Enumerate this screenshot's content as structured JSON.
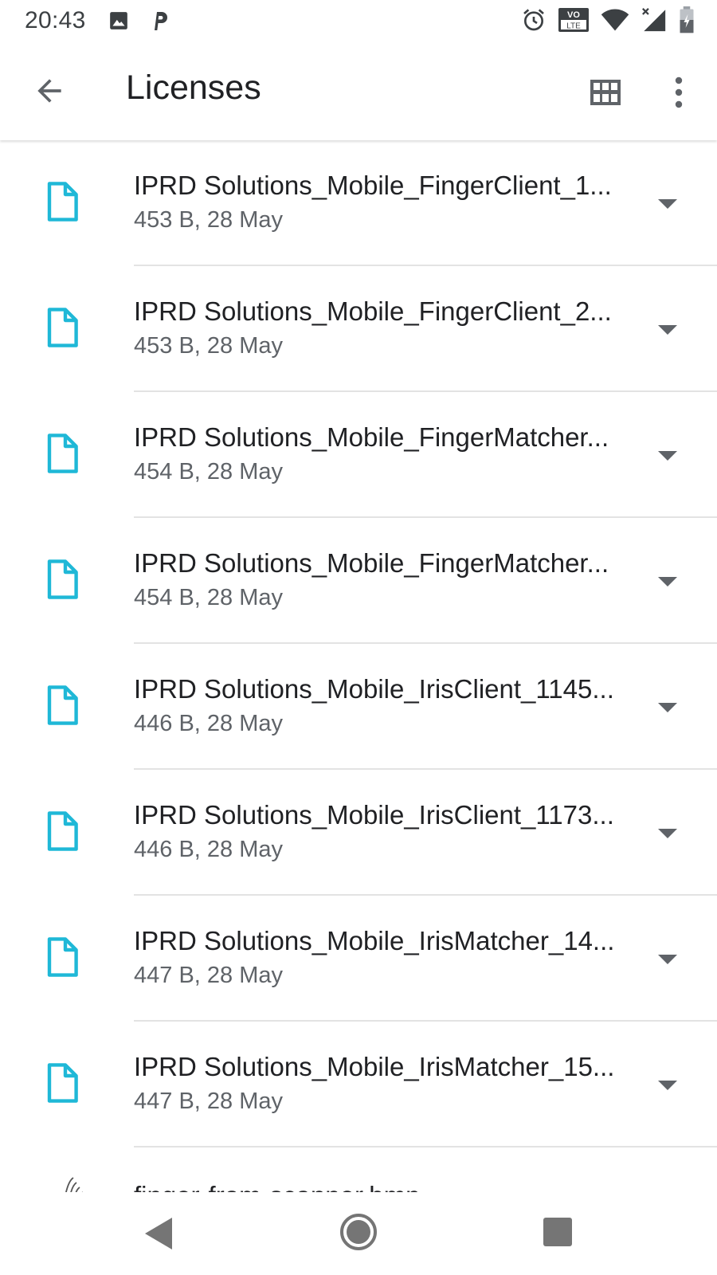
{
  "status_bar": {
    "time": "20:43",
    "left_icons": [
      "image-icon",
      "parking-icon"
    ],
    "right_icons": [
      "alarm-icon",
      "volte-icon",
      "wifi-icon",
      "signal-icon",
      "battery-icon"
    ],
    "volte_top": "VO",
    "volte_bottom": "LTE"
  },
  "app_bar": {
    "title": "Licenses",
    "back_icon": "arrow-back-icon",
    "view_icon": "grid-view-icon",
    "menu_icon": "more-vert-icon"
  },
  "files": [
    {
      "name": "IPRD Solutions_Mobile_FingerClient_1...",
      "meta": "453 B, 28 May"
    },
    {
      "name": "IPRD Solutions_Mobile_FingerClient_2...",
      "meta": "453 B, 28 May"
    },
    {
      "name": "IPRD Solutions_Mobile_FingerMatcher...",
      "meta": "454 B, 28 May"
    },
    {
      "name": "IPRD Solutions_Mobile_FingerMatcher...",
      "meta": "454 B, 28 May"
    },
    {
      "name": "IPRD Solutions_Mobile_IrisClient_1145...",
      "meta": "446 B, 28 May"
    },
    {
      "name": "IPRD Solutions_Mobile_IrisClient_1173...",
      "meta": "446 B, 28 May"
    },
    {
      "name": "IPRD Solutions_Mobile_IrisMatcher_14...",
      "meta": "447 B, 28 May"
    },
    {
      "name": "IPRD Solutions_Mobile_IrisMatcher_15...",
      "meta": "447 B, 28 May"
    }
  ],
  "partial_file": {
    "name": "finger-from-scanner.bmp"
  },
  "colors": {
    "file_icon": "#1FB8D7",
    "text_primary": "#202124",
    "text_secondary": "#5f6368",
    "icon_gray": "#5f6368",
    "nav_gray": "#757575"
  }
}
